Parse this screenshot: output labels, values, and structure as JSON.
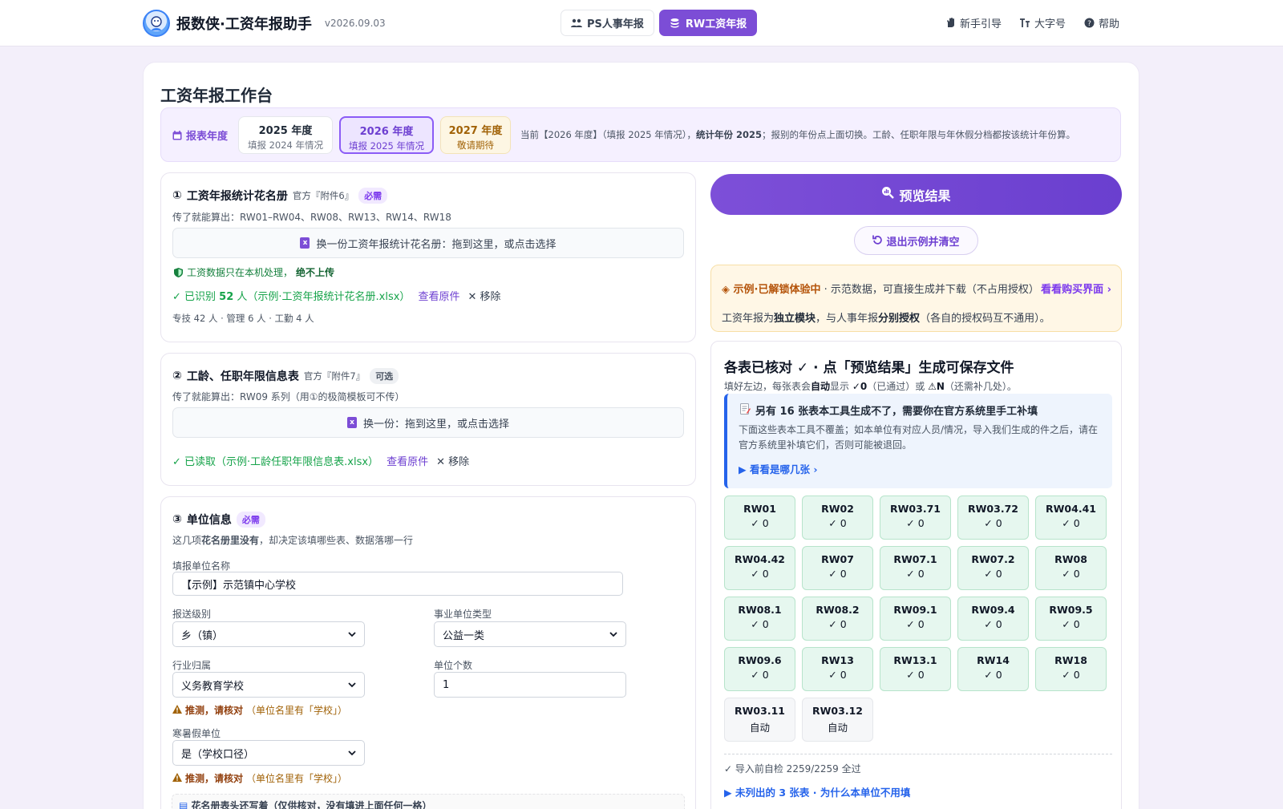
{
  "header": {
    "app_title": "报数侠·工资年报助手",
    "version": "v2026.09.03",
    "mode_tabs": [
      {
        "label": "PS人事年报",
        "icon": "users-icon",
        "active": false
      },
      {
        "label": "RW工资年报",
        "icon": "coins-icon",
        "active": true
      }
    ],
    "links": [
      {
        "label": "新手引导",
        "icon": "hand-icon"
      },
      {
        "label": "大字号",
        "icon": "font-size-icon"
      },
      {
        "label": "帮助",
        "icon": "help-icon"
      }
    ]
  },
  "page_title": "工资年报工作台",
  "year_bar": {
    "label": "报表年度",
    "options": [
      {
        "year": "2025 年度",
        "sub": "填报 2024 年情况",
        "state": "normal"
      },
      {
        "year": "2026 年度",
        "sub": "填报 2025 年情况",
        "state": "selected"
      },
      {
        "year": "2027 年度",
        "sub": "敬请期待",
        "state": "future"
      }
    ],
    "note_prefix": "当前【2026 年度】（填报 2025 年情况），",
    "note_bold": "统计年份 2025",
    "note_suffix": "；报别的年份点上面切换。工龄、任职年限与年休假分档都按该统计年份算。"
  },
  "panel1": {
    "num": "①",
    "title": "工资年报统计花名册",
    "official": "官方『附件6』",
    "tag": "必需",
    "desc": "传了就能算出：RW01–RW04、RW08、RW13、RW14、RW18",
    "drop_text": "换一份工资年报统计花名册：拖到这里，或点击选择",
    "privacy_prefix": "工资数据只在本机处理，",
    "privacy_bold": "绝不上传",
    "ok_prefix": "✓ 已识别 ",
    "ok_count": "52",
    "ok_suffix": " 人（示例·工资年报统计花名册.xlsx）",
    "view_original": "查看原件",
    "remove": "✕ 移除",
    "breakdown": "专技 42 人 · 管理 6 人 · 工勤 4 人"
  },
  "panel2": {
    "num": "②",
    "title": "工龄、任职年限信息表",
    "official": "官方『附件7』",
    "tag": "可选",
    "desc": "传了就能算出：RW09 系列（用①的极简模板可不传）",
    "drop_text": "换一份：拖到这里，或点击选择",
    "ok_text": "✓ 已读取（示例·工龄任职年限信息表.xlsx）",
    "view_original": "查看原件",
    "remove": "✕ 移除"
  },
  "panel3": {
    "num": "③",
    "title": "单位信息",
    "tag": "必需",
    "desc_prefix": "这几项",
    "desc_bold": "花名册里没有",
    "desc_suffix": "，却决定该填哪些表、数据落哪一行",
    "unit_name_label": "填报单位名称",
    "unit_name_value": "【示例】示范镇中心学校",
    "level_label": "报送级别",
    "level_value": "乡（镇）",
    "type_label": "事业单位类型",
    "type_value": "公益一类",
    "industry_label": "行业归属",
    "industry_value": "义务教育学校",
    "count_label": "单位个数",
    "count_value": "1",
    "warn_bold": "推测，请核对",
    "warn_rest": "（单位名里有「学校」）",
    "vacation_label": "寒暑假单位",
    "vacation_value": "是（学校口径）",
    "bottom_note": "花名册表头还写着（仅供核对，没有填进上面任何一格）"
  },
  "right": {
    "preview_label": "预览结果",
    "reset_label": "退出示例并清空",
    "demo_bold": "◈ 示例·已解锁体验中",
    "demo_text": " · 示范数据，可直接生成并下载（不占用授权）",
    "demo_link": "看看购买界面 ›",
    "module_prefix": "工资年报为",
    "module_bold1": "独立模块",
    "module_mid": "，与人事年报",
    "module_bold2": "分别授权",
    "module_suffix": "（各自的授权码互不通用）。",
    "check_title": "各表已核对 ✓ · 点「预览结果」生成可保存文件",
    "check_sub_prefix": "填好左边，每张表会",
    "check_sub_auto": "自动",
    "check_sub_mid": "显示 ",
    "check_sub_ok": "✓0",
    "check_sub_mid2": "（已通过）或 ",
    "check_sub_warn": "⚠N",
    "check_sub_suffix": "（还需补几处）。",
    "info_title": "另有 16 张表本工具生成不了，需要你在官方系统里手工补填",
    "info_body": "下面这些表本工具不覆盖；如本单位有对应人员/情况，导入我们生成的件之后，请在官方系统里补填它们，否则可能被退回。",
    "info_link": "▶ 看看是哪几张 ›",
    "tables": [
      {
        "name": "RW01",
        "status": "✓ 0"
      },
      {
        "name": "RW02",
        "status": "✓ 0"
      },
      {
        "name": "RW03.71",
        "status": "✓ 0"
      },
      {
        "name": "RW03.72",
        "status": "✓ 0"
      },
      {
        "name": "RW04.41",
        "status": "✓ 0"
      },
      {
        "name": "RW04.42",
        "status": "✓ 0"
      },
      {
        "name": "RW07",
        "status": "✓ 0"
      },
      {
        "name": "RW07.1",
        "status": "✓ 0"
      },
      {
        "name": "RW07.2",
        "status": "✓ 0"
      },
      {
        "name": "RW08",
        "status": "✓ 0"
      },
      {
        "name": "RW08.1",
        "status": "✓ 0"
      },
      {
        "name": "RW08.2",
        "status": "✓ 0"
      },
      {
        "name": "RW09.1",
        "status": "✓ 0"
      },
      {
        "name": "RW09.4",
        "status": "✓ 0"
      },
      {
        "name": "RW09.5",
        "status": "✓ 0"
      },
      {
        "name": "RW09.6",
        "status": "✓ 0"
      },
      {
        "name": "RW13",
        "status": "✓ 0"
      },
      {
        "name": "RW13.1",
        "status": "✓ 0"
      },
      {
        "name": "RW14",
        "status": "✓ 0"
      },
      {
        "name": "RW18",
        "status": "✓ 0"
      },
      {
        "name": "RW03.11",
        "status": "自动"
      },
      {
        "name": "RW03.12",
        "status": "自动"
      }
    ],
    "self_check": "✓ 导入前自检 2259/2259 全过",
    "unlisted": "▶ 未列出的 3 张表 · 为什么本单位不用填"
  },
  "colors": {
    "accent": "#7c4dd6",
    "success": "#16a34a",
    "warning": "#a16207",
    "info": "#2563eb"
  }
}
